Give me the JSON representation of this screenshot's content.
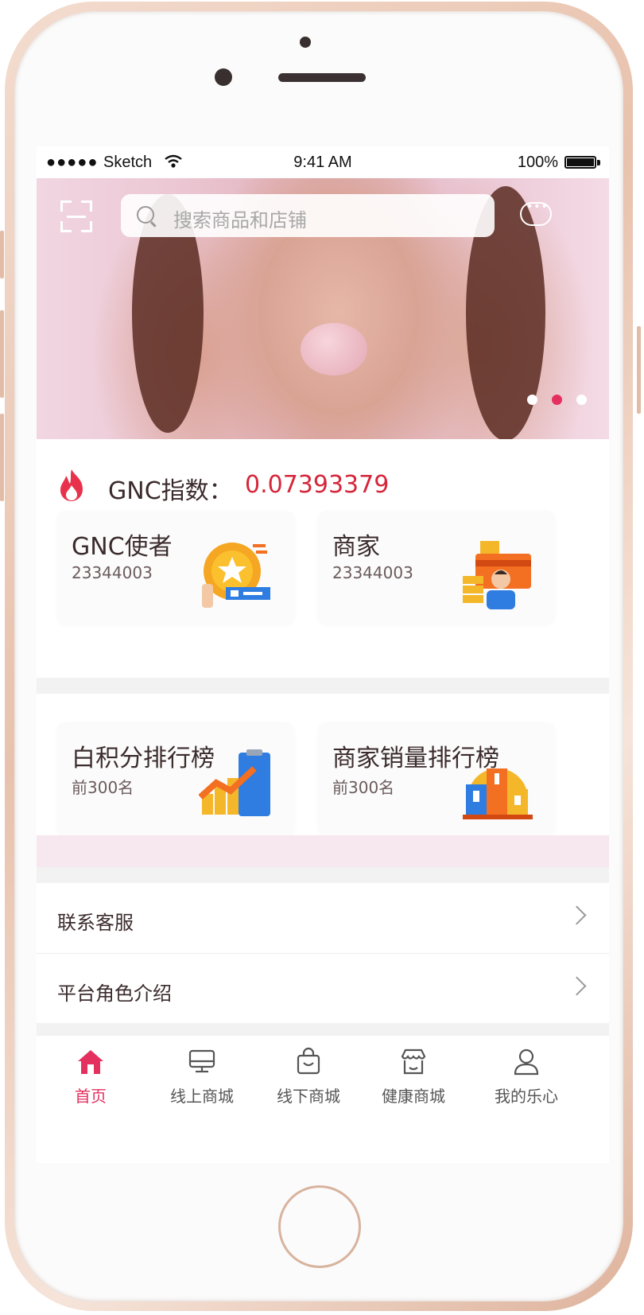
{
  "status_bar": {
    "signal": "●●●●●",
    "carrier": "Sketch",
    "time": "9:41 AM",
    "battery": "100%"
  },
  "search": {
    "placeholder": "搜索商品和店铺"
  },
  "banner": {
    "pages": 3,
    "active_index": 1
  },
  "gnc_index": {
    "label": "GNC指数：",
    "value": "0.07393379"
  },
  "stat_cards": [
    {
      "title": "GNC使者",
      "value": "23344003",
      "icon": "star-coin-icon"
    },
    {
      "title": "商家",
      "value": "23344003",
      "icon": "merchant-icon"
    }
  ],
  "rank_cards": [
    {
      "title": "白积分排行榜",
      "subtitle": "前300名",
      "icon": "growth-chart-icon"
    },
    {
      "title": "商家销量排行榜",
      "subtitle": "前300名",
      "icon": "podium-icon"
    }
  ],
  "menu": [
    {
      "label": "联系客服"
    },
    {
      "label": "平台角色介绍"
    }
  ],
  "tabs": [
    {
      "label": "首页",
      "icon": "home-icon",
      "active": true
    },
    {
      "label": "线上商城",
      "icon": "monitor-icon",
      "active": false
    },
    {
      "label": "线下商城",
      "icon": "shopping-bag-icon",
      "active": false
    },
    {
      "label": "健康商城",
      "icon": "store-icon",
      "active": false
    },
    {
      "label": "我的乐心",
      "icon": "user-icon",
      "active": false
    }
  ],
  "colors": {
    "accent": "#e4305e",
    "value_red": "#d5263a",
    "text": "#3b2b2c"
  }
}
